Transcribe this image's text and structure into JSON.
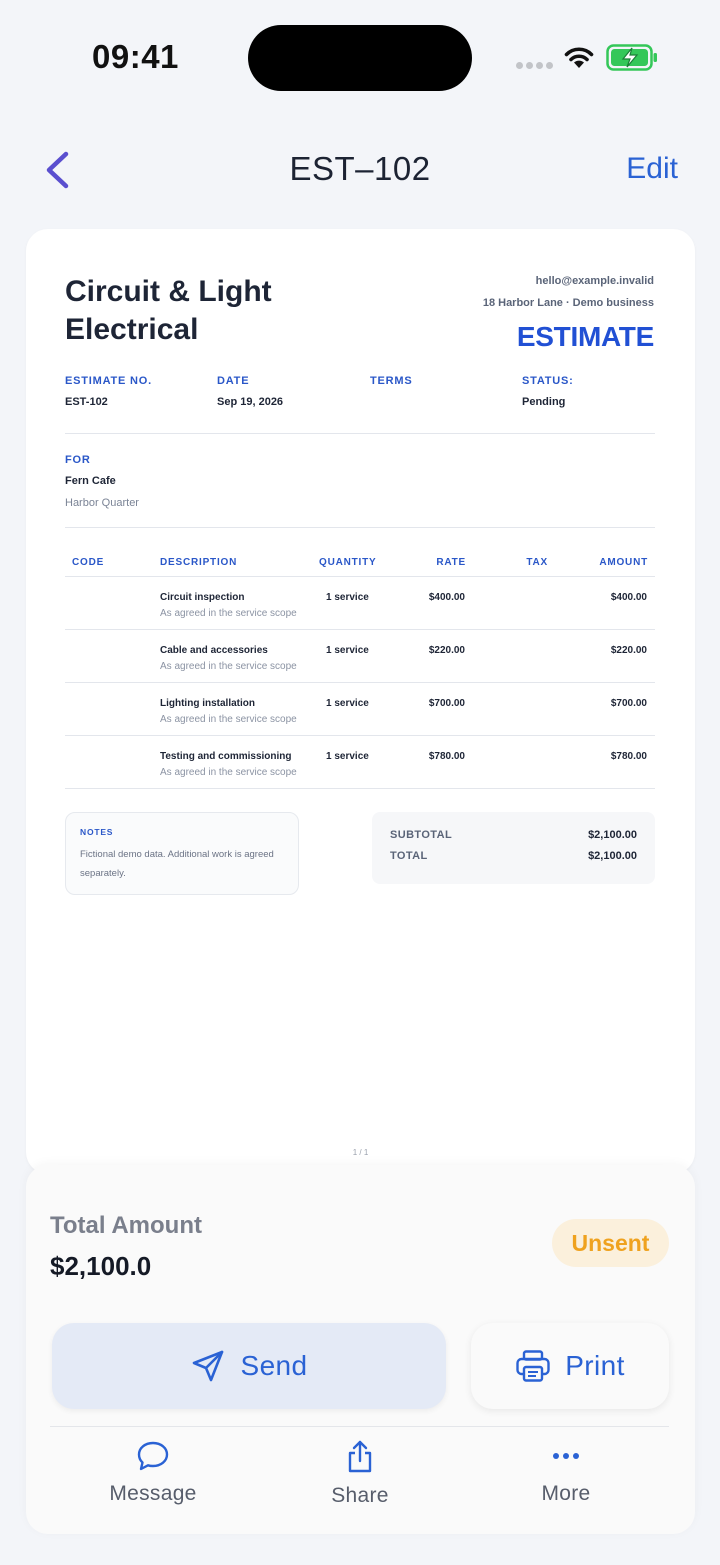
{
  "status_bar": {
    "time": "09:41"
  },
  "nav": {
    "title": "EST–102",
    "edit_label": "Edit"
  },
  "document": {
    "business_name": "Circuit & Light Electrical",
    "email": "hello@example.invalid",
    "address": "18 Harbor Lane · Demo business",
    "doc_type": "ESTIMATE",
    "meta": [
      {
        "label": "ESTIMATE NO.",
        "value": "EST-102"
      },
      {
        "label": "DATE",
        "value": "Sep 19, 2026"
      },
      {
        "label": "TERMS",
        "value": ""
      },
      {
        "label": "STATUS:",
        "value": "Pending"
      }
    ],
    "for_label": "FOR",
    "client_name": "Fern Cafe",
    "client_address": "Harbor Quarter",
    "columns": [
      "CODE",
      "DESCRIPTION",
      "QUANTITY",
      "RATE",
      "TAX",
      "AMOUNT"
    ],
    "items": [
      {
        "name": "Circuit inspection",
        "desc": "As agreed in the service scope",
        "qty": "1 service",
        "rate": "$400.00",
        "amount": "$400.00"
      },
      {
        "name": "Cable and accessories",
        "desc": "As agreed in the service scope",
        "qty": "1 service",
        "rate": "$220.00",
        "amount": "$220.00"
      },
      {
        "name": "Lighting installation",
        "desc": "As agreed in the service scope",
        "qty": "1 service",
        "rate": "$700.00",
        "amount": "$700.00"
      },
      {
        "name": "Testing and commissioning",
        "desc": "As agreed in the service scope",
        "qty": "1 service",
        "rate": "$780.00",
        "amount": "$780.00"
      }
    ],
    "notes_label": "NOTES",
    "notes_text": "Fictional demo data. Additional work is agreed separately.",
    "subtotal_label": "SUBTOTAL",
    "subtotal_value": "$2,100.00",
    "total_label": "TOTAL",
    "total_value": "$2,100.00",
    "page_indicator": "1 / 1"
  },
  "sheet": {
    "total_amount_label": "Total Amount",
    "total_amount_value": "$2,100.0",
    "badge": "Unsent",
    "send_label": "Send",
    "print_label": "Print",
    "actions": [
      {
        "label": "Message",
        "icon": "message-icon"
      },
      {
        "label": "Share",
        "icon": "share-icon"
      },
      {
        "label": "More",
        "icon": "more-icon"
      }
    ]
  },
  "colors": {
    "accent": "#2a62d4",
    "doc_blue": "#2150d4",
    "badge_text": "#efa21f",
    "badge_bg": "#fbf0dc",
    "battery_green": "#34c759"
  }
}
